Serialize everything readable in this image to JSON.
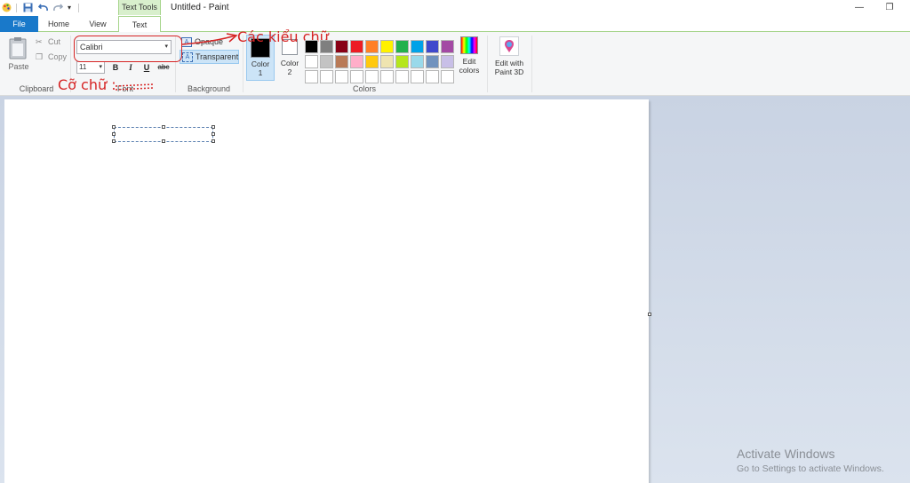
{
  "window": {
    "title": "Untitled - Paint",
    "context_tab_group": "Text Tools",
    "controls": {
      "minimize": "—",
      "restore": "❐"
    }
  },
  "tabs": {
    "file": "File",
    "home": "Home",
    "view": "View",
    "text": "Text"
  },
  "ribbon": {
    "clipboard": {
      "label": "Clipboard",
      "paste": "Paste",
      "cut": "Cut",
      "copy": "Copy"
    },
    "font": {
      "label": "Font",
      "family": "Calibri",
      "size": "11",
      "bold": "B",
      "italic": "I",
      "underline": "U",
      "strike": "abc"
    },
    "background": {
      "label": "Background",
      "opaque": "Opaque",
      "transparent": "Transparent",
      "selected": "transparent"
    },
    "colors": {
      "label": "Colors",
      "color1": "Color 1",
      "color2": "Color 2",
      "color1_value": "#000000",
      "color2_value": "#ffffff",
      "edit_colors": "Edit colors",
      "palette_row1": [
        "#000000",
        "#7f7f7f",
        "#880015",
        "#ed1c24",
        "#ff7f27",
        "#fff200",
        "#22b14c",
        "#00a2e8",
        "#3f48cc",
        "#a349a4"
      ],
      "palette_row2": [
        "#ffffff",
        "#c3c3c3",
        "#b97a57",
        "#ffaec9",
        "#ffc90e",
        "#efe4b0",
        "#b5e61d",
        "#99d9ea",
        "#7092be",
        "#c8bfe7"
      ],
      "palette_row3": [
        "#ffffff",
        "#ffffff",
        "#ffffff",
        "#ffffff",
        "#ffffff",
        "#ffffff",
        "#ffffff",
        "#ffffff",
        "#ffffff",
        "#ffffff"
      ]
    },
    "paint3d": {
      "label": "Edit with Paint 3D"
    }
  },
  "annotations": {
    "font_styles": "Các kiểu chữ",
    "font_size": "Cỡ chữ :"
  },
  "watermark": {
    "title": "Activate Windows",
    "subtitle": "Go to Settings to activate Windows."
  }
}
